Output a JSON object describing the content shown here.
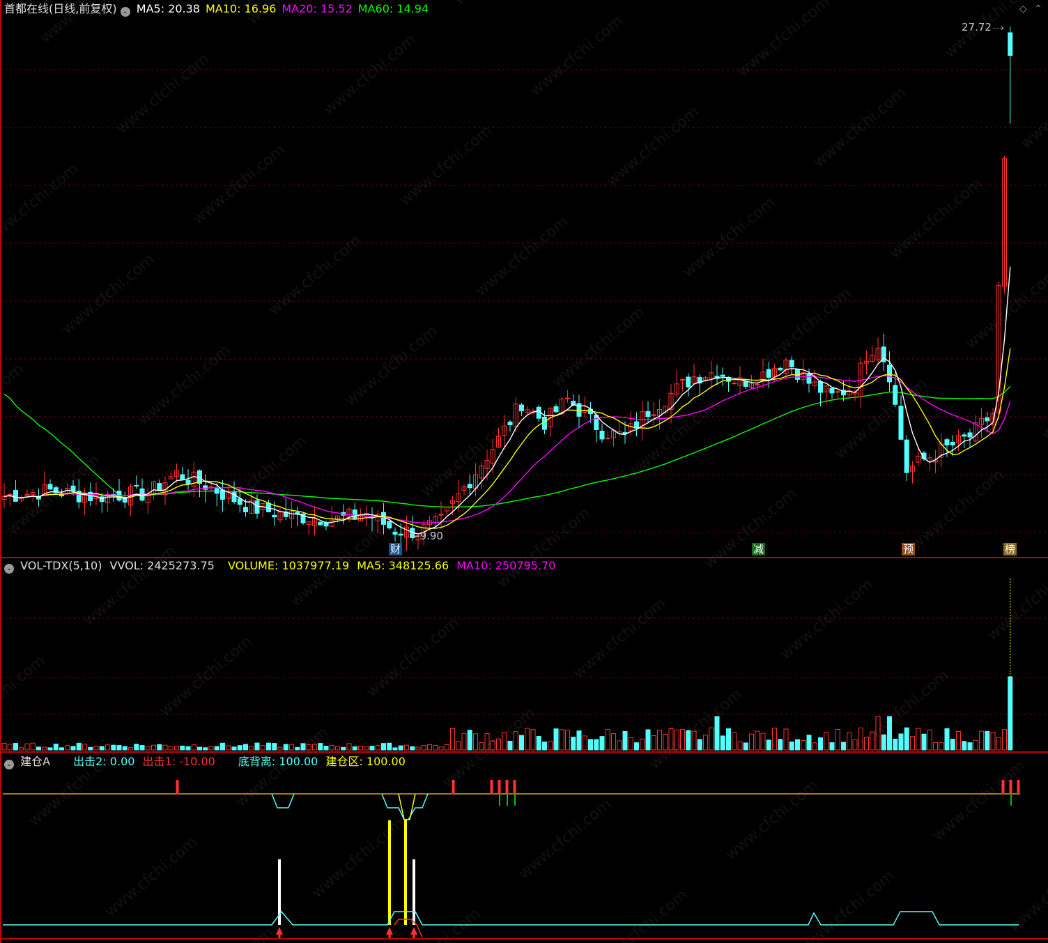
{
  "main_panel": {
    "title": "首都在线(日线,前复权)",
    "ma_labels": [
      {
        "text": "MA5: 20.38",
        "color": "#ffffff"
      },
      {
        "text": "MA10: 16.96",
        "color": "#ffff00"
      },
      {
        "text": "MA20: 15.52",
        "color": "#ff00ff"
      },
      {
        "text": "MA60: 14.94",
        "color": "#00ff00"
      }
    ],
    "high_label": "27.72",
    "low_label": "9.90",
    "event_markers": [
      {
        "text": "财",
        "bg": "#1e4e8c",
        "color": "#ffffff"
      },
      {
        "text": "减",
        "bg": "#1c6b1c",
        "color": "#ffffff"
      },
      {
        "text": "预",
        "bg": "#9a4a10",
        "color": "#ffffff"
      },
      {
        "text": "榜",
        "bg": "#8a6a20",
        "color": "#ffffff"
      }
    ]
  },
  "volume_panel": {
    "indicator": "VOL-TDX(5,10)",
    "vvol": "VVOL: 2425273.75",
    "volume": "VOLUME: 1037977.19",
    "ma5": "MA5: 348125.66",
    "ma10": "MA10: 250795.70"
  },
  "signal_panel": {
    "name": "建仓A",
    "chuji2": "出击2: 0.00",
    "chuji1": "出击1: -10.00",
    "dibeili": "底背离: 100.00",
    "jiancangqu": "建仓区: 100.00"
  },
  "colors": {
    "up": "#ff3232",
    "down": "#54ffff",
    "ma5": "#ffffff",
    "ma10": "#ffff00",
    "ma20": "#ff00ff",
    "ma60": "#00ff00",
    "divider": "#c00000",
    "grid": "#7a0000"
  },
  "watermark": "www.cfchi.com",
  "icons": [
    "panel-toggle-icon",
    "diamond-icon",
    "chevron-up-icon"
  ]
}
